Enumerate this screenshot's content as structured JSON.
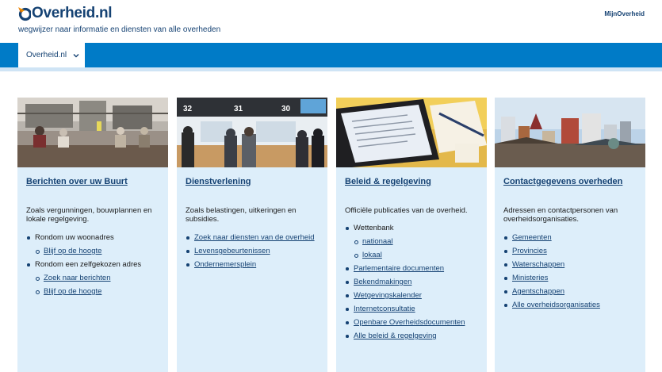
{
  "header": {
    "logo_text": "Overheid.nl",
    "tagline": "wegwijzer naar informatie en diensten van alle overheden",
    "mijn_link": "MijnOverheid"
  },
  "nav": {
    "tab_label": "Overheid.nl"
  },
  "colors": {
    "brand_dark": "#154273",
    "nav_blue": "#007bc7",
    "card_bg": "#ddeefa",
    "logo_orange": "#e17000"
  },
  "cards": [
    {
      "title": "Berichten over uw Buurt",
      "description": "Zoals vergunningen, bouwplannen en lokale regelgeving.",
      "items": [
        {
          "label": "Rondom uw woonadres",
          "link": false,
          "level": 1
        },
        {
          "label": "Blijf op de hoogte",
          "link": true,
          "level": 2
        },
        {
          "label": "Rondom een zelfgekozen adres",
          "link": false,
          "level": 1
        },
        {
          "label": "Zoek naar berichten",
          "link": true,
          "level": 2
        },
        {
          "label": "Blijf op de hoogte",
          "link": true,
          "level": 2
        }
      ]
    },
    {
      "title": "Dienstverlening",
      "description": "Zoals belastingen, uitkeringen en subsidies.",
      "items": [
        {
          "label": "Zoek naar diensten van de overheid",
          "link": true,
          "level": 1
        },
        {
          "label": "Levensgebeurtenissen",
          "link": true,
          "level": 1
        },
        {
          "label": "Ondernemersplein",
          "link": true,
          "level": 1
        }
      ]
    },
    {
      "title": "Beleid & regelgeving",
      "description": "Officiële publicaties van de overheid.",
      "items": [
        {
          "label": "Wettenbank",
          "link": false,
          "level": 1
        },
        {
          "label": "nationaal",
          "link": true,
          "level": 2
        },
        {
          "label": "lokaal",
          "link": true,
          "level": 2
        },
        {
          "label": "Parlementaire documenten",
          "link": true,
          "level": 1
        },
        {
          "label": "Bekendmakingen",
          "link": true,
          "level": 1
        },
        {
          "label": "Wetgevingskalender",
          "link": true,
          "level": 1
        },
        {
          "label": "Internetconsultatie",
          "link": true,
          "level": 1
        },
        {
          "label": "Openbare Overheidsdocumenten",
          "link": true,
          "level": 1
        },
        {
          "label": "Alle beleid & regelgeving",
          "link": true,
          "level": 1
        }
      ]
    },
    {
      "title": "Contactgegevens overheden",
      "description": "Adressen en contactpersonen van overheidsorganisaties.",
      "items": [
        {
          "label": "Gemeenten",
          "link": true,
          "level": 1
        },
        {
          "label": "Provincies",
          "link": true,
          "level": 1
        },
        {
          "label": "Waterschappen",
          "link": true,
          "level": 1
        },
        {
          "label": "Ministeries",
          "link": true,
          "level": 1
        },
        {
          "label": "Agentschappen",
          "link": true,
          "level": 1
        },
        {
          "label": "Alle overheidsorganisaties",
          "link": true,
          "level": 1
        }
      ]
    }
  ],
  "photo_signs": [
    "32",
    "31",
    "30"
  ]
}
